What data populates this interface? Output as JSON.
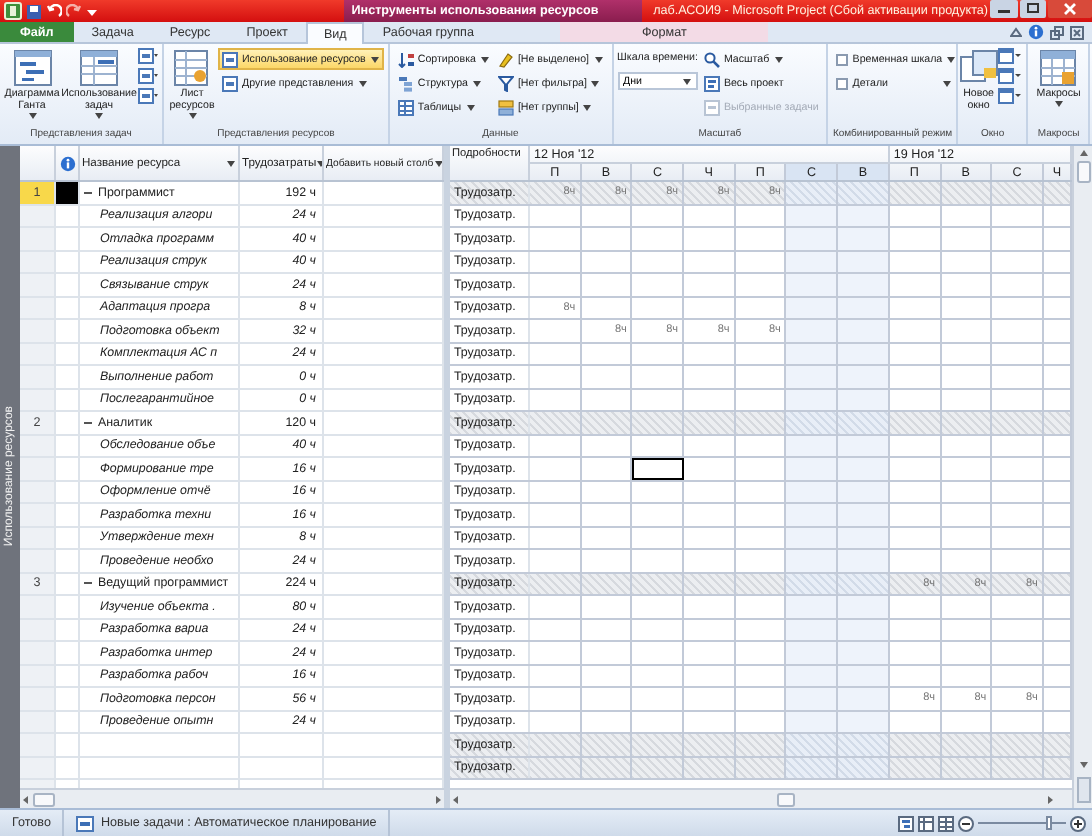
{
  "title_bar": {
    "context_title": "Инструменты использования ресурсов",
    "title": "лаб.АСОИ9 - Microsoft Project (Сбой активации продукта)"
  },
  "tabs": [
    {
      "label": "Файл",
      "kind": "file",
      "selected": false
    },
    {
      "label": "Задача",
      "kind": "normal",
      "selected": false
    },
    {
      "label": "Ресурс",
      "kind": "normal",
      "selected": false
    },
    {
      "label": "Проект",
      "kind": "normal",
      "selected": false
    },
    {
      "label": "Вид",
      "kind": "normal",
      "selected": true
    },
    {
      "label": "Рабочая группа",
      "kind": "normal",
      "selected": false
    },
    {
      "label": "Формат",
      "kind": "context",
      "selected": false
    }
  ],
  "ribbon": {
    "task_views": {
      "label": "Представления задач",
      "gantt": "Диаграмма Ганта",
      "task_usage": "Использование задач"
    },
    "resource_views": {
      "label": "Представления ресурсов",
      "resource_sheet": "Лист ресурсов",
      "resource_usage": {
        "label": "Использование ресурсов",
        "selected": true
      },
      "other_views": "Другие представления"
    },
    "data": {
      "label": "Данные",
      "sort": "Сортировка",
      "outline": "Структура",
      "tables": "Таблицы",
      "highlight": "[Не выделено]",
      "filter": "[Нет фильтра]",
      "group": "[Нет группы]"
    },
    "zoom": {
      "label": "Масштаб",
      "timescale_label": "Шкала времени:",
      "timescale": "Дни",
      "zoom": "Масштаб",
      "entire_project": "Весь проект",
      "selected_tasks": {
        "label": "Выбранные задачи",
        "disabled": true
      }
    },
    "split_view": {
      "label": "Комбинированный режим",
      "options": [
        {
          "label": "Временная шкала",
          "checked": false
        },
        {
          "label": "Детали",
          "checked": false
        }
      ]
    },
    "window": {
      "label": "Окно",
      "new_window": "Новое окно"
    },
    "macros": {
      "label": "Макросы",
      "macros": "Макросы"
    }
  },
  "view_bar": {
    "label": "Использование ресурсов"
  },
  "resource_table": {
    "columns": [
      "Название ресурса",
      "Трудозатраты",
      "Добавить новый столб"
    ],
    "rows": [
      {
        "number": "1",
        "name": "Программист",
        "work": "192 ч",
        "expanded": true,
        "selected": true,
        "children": [
          {
            "name": "Реализация алгори",
            "work": "24 ч"
          },
          {
            "name": "Отладка программ",
            "work": "40 ч"
          },
          {
            "name": "Реализация струк",
            "work": "40 ч"
          },
          {
            "name": "Связывание струк",
            "work": "24 ч"
          },
          {
            "name": "Адаптация програ",
            "work": "8 ч"
          },
          {
            "name": "Подготовка объект",
            "work": "32 ч"
          },
          {
            "name": "Комплектация АС п",
            "work": "24 ч"
          },
          {
            "name": "Выполнение работ",
            "work": "0 ч"
          },
          {
            "name": "Послегарантийное",
            "work": "0 ч"
          }
        ]
      },
      {
        "number": "2",
        "name": "Аналитик",
        "work": "120 ч",
        "expanded": true,
        "selected": false,
        "children": [
          {
            "name": "Обследование объе",
            "work": "40 ч"
          },
          {
            "name": "Формирование тре",
            "work": "16 ч"
          },
          {
            "name": "Оформление отчё",
            "work": "16 ч"
          },
          {
            "name": "Разработка техни",
            "work": "16 ч"
          },
          {
            "name": "Утверждение техн",
            "work": "8 ч"
          },
          {
            "name": "Проведение необхо",
            "work": "24 ч"
          }
        ]
      },
      {
        "number": "3",
        "name": "Ведущий программист",
        "work": "224 ч",
        "expanded": true,
        "selected": false,
        "children": [
          {
            "name": "Изучение объекта .",
            "work": "80 ч"
          },
          {
            "name": "Разработка вариа",
            "work": "24 ч"
          },
          {
            "name": "Разработка интер",
            "work": "24 ч"
          },
          {
            "name": "Разработка рабоч",
            "work": "16 ч"
          },
          {
            "name": "Подготовка персон",
            "work": "56 ч"
          },
          {
            "name": "Проведение опытн",
            "work": "24 ч"
          }
        ]
      }
    ]
  },
  "usage_grid": {
    "details_label": "Подробности",
    "weeks": [
      {
        "label": "12 Ноя '12"
      },
      {
        "label": "19 Ноя '12"
      }
    ],
    "days": [
      {
        "label": "П",
        "weekend": false,
        "selected": false
      },
      {
        "label": "В",
        "weekend": false,
        "selected": false
      },
      {
        "label": "С",
        "weekend": false,
        "selected": true
      },
      {
        "label": "Ч",
        "weekend": false,
        "selected": false
      },
      {
        "label": "П",
        "weekend": false,
        "selected": false
      },
      {
        "label": "С",
        "weekend": true,
        "selected": false
      },
      {
        "label": "В",
        "weekend": true,
        "selected": false
      },
      {
        "label": "П",
        "weekend": false,
        "selected": false
      },
      {
        "label": "В",
        "weekend": false,
        "selected": false
      },
      {
        "label": "С",
        "weekend": false,
        "selected": false
      },
      {
        "label": "Ч",
        "weekend": false,
        "selected": false
      }
    ],
    "rows": [
      {
        "label": "Трудозатр.",
        "summary": true,
        "selected": false,
        "cells": [
          {
            "kind": "work",
            "text": "8ч"
          },
          {
            "kind": "work",
            "text": "8ч"
          },
          {
            "kind": "work",
            "text": "8ч"
          },
          {
            "kind": "work",
            "text": "8ч"
          },
          {
            "kind": "work",
            "text": "8ч"
          },
          {
            "kind": "empty"
          },
          {
            "kind": "empty"
          },
          {
            "kind": "empty"
          },
          {
            "kind": "empty"
          },
          {
            "kind": "empty"
          },
          {
            "kind": "empty"
          }
        ]
      },
      {
        "label": "Трудозатр.",
        "summary": false,
        "selected": false,
        "cells": [
          {
            "kind": "empty"
          },
          {
            "kind": "empty"
          },
          {
            "kind": "empty"
          },
          {
            "kind": "empty"
          },
          {
            "kind": "empty"
          },
          {
            "kind": "empty"
          },
          {
            "kind": "empty"
          },
          {
            "kind": "empty"
          },
          {
            "kind": "empty"
          },
          {
            "kind": "empty"
          },
          {
            "kind": "empty"
          }
        ]
      },
      {
        "label": "Трудозатр.",
        "summary": false,
        "selected": false,
        "cells": [
          {
            "kind": "empty"
          },
          {
            "kind": "empty"
          },
          {
            "kind": "empty"
          },
          {
            "kind": "empty"
          },
          {
            "kind": "empty"
          },
          {
            "kind": "empty"
          },
          {
            "kind": "empty"
          },
          {
            "kind": "empty"
          },
          {
            "kind": "empty"
          },
          {
            "kind": "empty"
          },
          {
            "kind": "empty"
          }
        ]
      },
      {
        "label": "Трудозатр.",
        "summary": false,
        "selected": false,
        "cells": [
          {
            "kind": "empty"
          },
          {
            "kind": "empty"
          },
          {
            "kind": "empty"
          },
          {
            "kind": "empty"
          },
          {
            "kind": "empty"
          },
          {
            "kind": "empty"
          },
          {
            "kind": "empty"
          },
          {
            "kind": "empty"
          },
          {
            "kind": "empty"
          },
          {
            "kind": "empty"
          },
          {
            "kind": "empty"
          }
        ]
      },
      {
        "label": "Трудозатр.",
        "summary": false,
        "selected": false,
        "cells": [
          {
            "kind": "empty"
          },
          {
            "kind": "empty"
          },
          {
            "kind": "empty"
          },
          {
            "kind": "empty"
          },
          {
            "kind": "empty"
          },
          {
            "kind": "empty"
          },
          {
            "kind": "empty"
          },
          {
            "kind": "empty"
          },
          {
            "kind": "empty"
          },
          {
            "kind": "empty"
          },
          {
            "kind": "empty"
          }
        ]
      },
      {
        "label": "Трудозатр.",
        "summary": false,
        "selected": false,
        "cells": [
          {
            "kind": "work",
            "text": "8ч"
          },
          {
            "kind": "empty"
          },
          {
            "kind": "empty"
          },
          {
            "kind": "empty"
          },
          {
            "kind": "empty"
          },
          {
            "kind": "empty"
          },
          {
            "kind": "empty"
          },
          {
            "kind": "empty"
          },
          {
            "kind": "empty"
          },
          {
            "kind": "empty"
          },
          {
            "kind": "empty"
          }
        ]
      },
      {
        "label": "Трудозатр.",
        "summary": false,
        "selected": false,
        "cells": [
          {
            "kind": "empty"
          },
          {
            "kind": "work",
            "text": "8ч"
          },
          {
            "kind": "work",
            "text": "8ч"
          },
          {
            "kind": "work",
            "text": "8ч"
          },
          {
            "kind": "work",
            "text": "8ч"
          },
          {
            "kind": "empty"
          },
          {
            "kind": "empty"
          },
          {
            "kind": "empty"
          },
          {
            "kind": "empty"
          },
          {
            "kind": "empty"
          },
          {
            "kind": "empty"
          }
        ]
      },
      {
        "label": "Трудозатр.",
        "summary": false,
        "selected": false,
        "cells": [
          {
            "kind": "empty"
          },
          {
            "kind": "empty"
          },
          {
            "kind": "empty"
          },
          {
            "kind": "empty"
          },
          {
            "kind": "empty"
          },
          {
            "kind": "empty"
          },
          {
            "kind": "empty"
          },
          {
            "kind": "empty"
          },
          {
            "kind": "empty"
          },
          {
            "kind": "empty"
          },
          {
            "kind": "empty"
          }
        ]
      },
      {
        "label": "Трудозатр.",
        "summary": false,
        "selected": false,
        "cells": [
          {
            "kind": "empty"
          },
          {
            "kind": "empty"
          },
          {
            "kind": "empty"
          },
          {
            "kind": "empty"
          },
          {
            "kind": "empty"
          },
          {
            "kind": "empty"
          },
          {
            "kind": "empty"
          },
          {
            "kind": "empty"
          },
          {
            "kind": "empty"
          },
          {
            "kind": "empty"
          },
          {
            "kind": "empty"
          }
        ]
      },
      {
        "label": "Трудозатр.",
        "summary": false,
        "selected": false,
        "cells": [
          {
            "kind": "empty"
          },
          {
            "kind": "empty"
          },
          {
            "kind": "empty"
          },
          {
            "kind": "empty"
          },
          {
            "kind": "empty"
          },
          {
            "kind": "empty"
          },
          {
            "kind": "empty"
          },
          {
            "kind": "empty"
          },
          {
            "kind": "empty"
          },
          {
            "kind": "empty"
          },
          {
            "kind": "empty"
          }
        ]
      },
      {
        "label": "Трудозатр.",
        "summary": true,
        "selected": false,
        "cells": [
          {
            "kind": "empty"
          },
          {
            "kind": "empty"
          },
          {
            "kind": "empty"
          },
          {
            "kind": "empty"
          },
          {
            "kind": "empty"
          },
          {
            "kind": "empty"
          },
          {
            "kind": "empty"
          },
          {
            "kind": "empty"
          },
          {
            "kind": "empty"
          },
          {
            "kind": "empty"
          },
          {
            "kind": "empty"
          }
        ]
      },
      {
        "label": "Трудозатр.",
        "summary": false,
        "selected": false,
        "cells": [
          {
            "kind": "empty"
          },
          {
            "kind": "empty"
          },
          {
            "kind": "empty"
          },
          {
            "kind": "empty"
          },
          {
            "kind": "empty"
          },
          {
            "kind": "empty"
          },
          {
            "kind": "empty"
          },
          {
            "kind": "empty"
          },
          {
            "kind": "empty"
          },
          {
            "kind": "empty"
          },
          {
            "kind": "empty"
          }
        ]
      },
      {
        "label": "Трудозатр.",
        "summary": false,
        "selected": true,
        "cells": [
          {
            "kind": "empty"
          },
          {
            "kind": "empty"
          },
          {
            "kind": "empty"
          },
          {
            "kind": "empty"
          },
          {
            "kind": "empty"
          },
          {
            "kind": "empty"
          },
          {
            "kind": "empty"
          },
          {
            "kind": "empty"
          },
          {
            "kind": "empty"
          },
          {
            "kind": "empty"
          },
          {
            "kind": "empty"
          }
        ]
      },
      {
        "label": "Трудозатр.",
        "summary": false,
        "selected": false,
        "cells": [
          {
            "kind": "empty"
          },
          {
            "kind": "empty"
          },
          {
            "kind": "empty"
          },
          {
            "kind": "empty"
          },
          {
            "kind": "empty"
          },
          {
            "kind": "empty"
          },
          {
            "kind": "empty"
          },
          {
            "kind": "empty"
          },
          {
            "kind": "empty"
          },
          {
            "kind": "empty"
          },
          {
            "kind": "empty"
          }
        ]
      },
      {
        "label": "Трудозатр.",
        "summary": false,
        "selected": false,
        "cells": [
          {
            "kind": "empty"
          },
          {
            "kind": "empty"
          },
          {
            "kind": "empty"
          },
          {
            "kind": "empty"
          },
          {
            "kind": "empty"
          },
          {
            "kind": "empty"
          },
          {
            "kind": "empty"
          },
          {
            "kind": "empty"
          },
          {
            "kind": "empty"
          },
          {
            "kind": "empty"
          },
          {
            "kind": "empty"
          }
        ]
      },
      {
        "label": "Трудозатр.",
        "summary": false,
        "selected": false,
        "cells": [
          {
            "kind": "empty"
          },
          {
            "kind": "empty"
          },
          {
            "kind": "empty"
          },
          {
            "kind": "empty"
          },
          {
            "kind": "empty"
          },
          {
            "kind": "empty"
          },
          {
            "kind": "empty"
          },
          {
            "kind": "empty"
          },
          {
            "kind": "empty"
          },
          {
            "kind": "empty"
          },
          {
            "kind": "empty"
          }
        ]
      },
      {
        "label": "Трудозатр.",
        "summary": false,
        "selected": false,
        "cells": [
          {
            "kind": "empty"
          },
          {
            "kind": "empty"
          },
          {
            "kind": "empty"
          },
          {
            "kind": "empty"
          },
          {
            "kind": "empty"
          },
          {
            "kind": "empty"
          },
          {
            "kind": "empty"
          },
          {
            "kind": "empty"
          },
          {
            "kind": "empty"
          },
          {
            "kind": "empty"
          },
          {
            "kind": "empty"
          }
        ]
      },
      {
        "label": "Трудозатр.",
        "summary": true,
        "selected": false,
        "cells": [
          {
            "kind": "empty"
          },
          {
            "kind": "empty"
          },
          {
            "kind": "empty"
          },
          {
            "kind": "empty"
          },
          {
            "kind": "empty"
          },
          {
            "kind": "empty"
          },
          {
            "kind": "empty"
          },
          {
            "kind": "work",
            "text": "8ч"
          },
          {
            "kind": "work",
            "text": "8ч"
          },
          {
            "kind": "work",
            "text": "8ч"
          },
          {
            "kind": "empty"
          }
        ]
      },
      {
        "label": "Трудозатр.",
        "summary": false,
        "selected": false,
        "cells": [
          {
            "kind": "empty"
          },
          {
            "kind": "empty"
          },
          {
            "kind": "empty"
          },
          {
            "kind": "empty"
          },
          {
            "kind": "empty"
          },
          {
            "kind": "empty"
          },
          {
            "kind": "empty"
          },
          {
            "kind": "empty"
          },
          {
            "kind": "empty"
          },
          {
            "kind": "empty"
          },
          {
            "kind": "empty"
          }
        ]
      },
      {
        "label": "Трудозатр.",
        "summary": false,
        "selected": false,
        "cells": [
          {
            "kind": "empty"
          },
          {
            "kind": "empty"
          },
          {
            "kind": "empty"
          },
          {
            "kind": "empty"
          },
          {
            "kind": "empty"
          },
          {
            "kind": "empty"
          },
          {
            "kind": "empty"
          },
          {
            "kind": "empty"
          },
          {
            "kind": "empty"
          },
          {
            "kind": "empty"
          },
          {
            "kind": "empty"
          }
        ]
      },
      {
        "label": "Трудозатр.",
        "summary": false,
        "selected": false,
        "cells": [
          {
            "kind": "empty"
          },
          {
            "kind": "empty"
          },
          {
            "kind": "empty"
          },
          {
            "kind": "empty"
          },
          {
            "kind": "empty"
          },
          {
            "kind": "empty"
          },
          {
            "kind": "empty"
          },
          {
            "kind": "empty"
          },
          {
            "kind": "empty"
          },
          {
            "kind": "empty"
          },
          {
            "kind": "empty"
          }
        ]
      },
      {
        "label": "Трудозатр.",
        "summary": false,
        "selected": false,
        "cells": [
          {
            "kind": "empty"
          },
          {
            "kind": "empty"
          },
          {
            "kind": "empty"
          },
          {
            "kind": "empty"
          },
          {
            "kind": "empty"
          },
          {
            "kind": "empty"
          },
          {
            "kind": "empty"
          },
          {
            "kind": "empty"
          },
          {
            "kind": "empty"
          },
          {
            "kind": "empty"
          },
          {
            "kind": "empty"
          }
        ]
      },
      {
        "label": "Трудозатр.",
        "summary": false,
        "selected": false,
        "cells": [
          {
            "kind": "empty"
          },
          {
            "kind": "empty"
          },
          {
            "kind": "empty"
          },
          {
            "kind": "empty"
          },
          {
            "kind": "empty"
          },
          {
            "kind": "empty"
          },
          {
            "kind": "empty"
          },
          {
            "kind": "work",
            "text": "8ч"
          },
          {
            "kind": "work",
            "text": "8ч"
          },
          {
            "kind": "work",
            "text": "8ч"
          },
          {
            "kind": "empty"
          }
        ]
      },
      {
        "label": "Трудозатр.",
        "summary": false,
        "selected": false,
        "cells": [
          {
            "kind": "empty"
          },
          {
            "kind": "empty"
          },
          {
            "kind": "empty"
          },
          {
            "kind": "empty"
          },
          {
            "kind": "empty"
          },
          {
            "kind": "empty"
          },
          {
            "kind": "empty"
          },
          {
            "kind": "empty"
          },
          {
            "kind": "empty"
          },
          {
            "kind": "empty"
          },
          {
            "kind": "empty"
          }
        ]
      },
      {
        "label": "Трудозатр.",
        "summary": true,
        "selected": false,
        "cells": [
          {
            "kind": "empty"
          },
          {
            "kind": "empty"
          },
          {
            "kind": "empty"
          },
          {
            "kind": "empty"
          },
          {
            "kind": "empty"
          },
          {
            "kind": "empty"
          },
          {
            "kind": "empty"
          },
          {
            "kind": "empty"
          },
          {
            "kind": "empty"
          },
          {
            "kind": "empty"
          },
          {
            "kind": "empty"
          }
        ]
      },
      {
        "label": "Трудозатр.",
        "summary": true,
        "selected": false,
        "cells": [
          {
            "kind": "empty"
          },
          {
            "kind": "empty"
          },
          {
            "kind": "empty"
          },
          {
            "kind": "empty"
          },
          {
            "kind": "empty"
          },
          {
            "kind": "empty"
          },
          {
            "kind": "empty"
          },
          {
            "kind": "empty"
          },
          {
            "kind": "empty"
          },
          {
            "kind": "empty"
          },
          {
            "kind": "empty"
          }
        ]
      }
    ]
  },
  "status_bar": {
    "ready": "Готово",
    "task_mode": "Новые задачи : Автоматическое планирование",
    "zoom": {
      "level": 0.8
    }
  }
}
